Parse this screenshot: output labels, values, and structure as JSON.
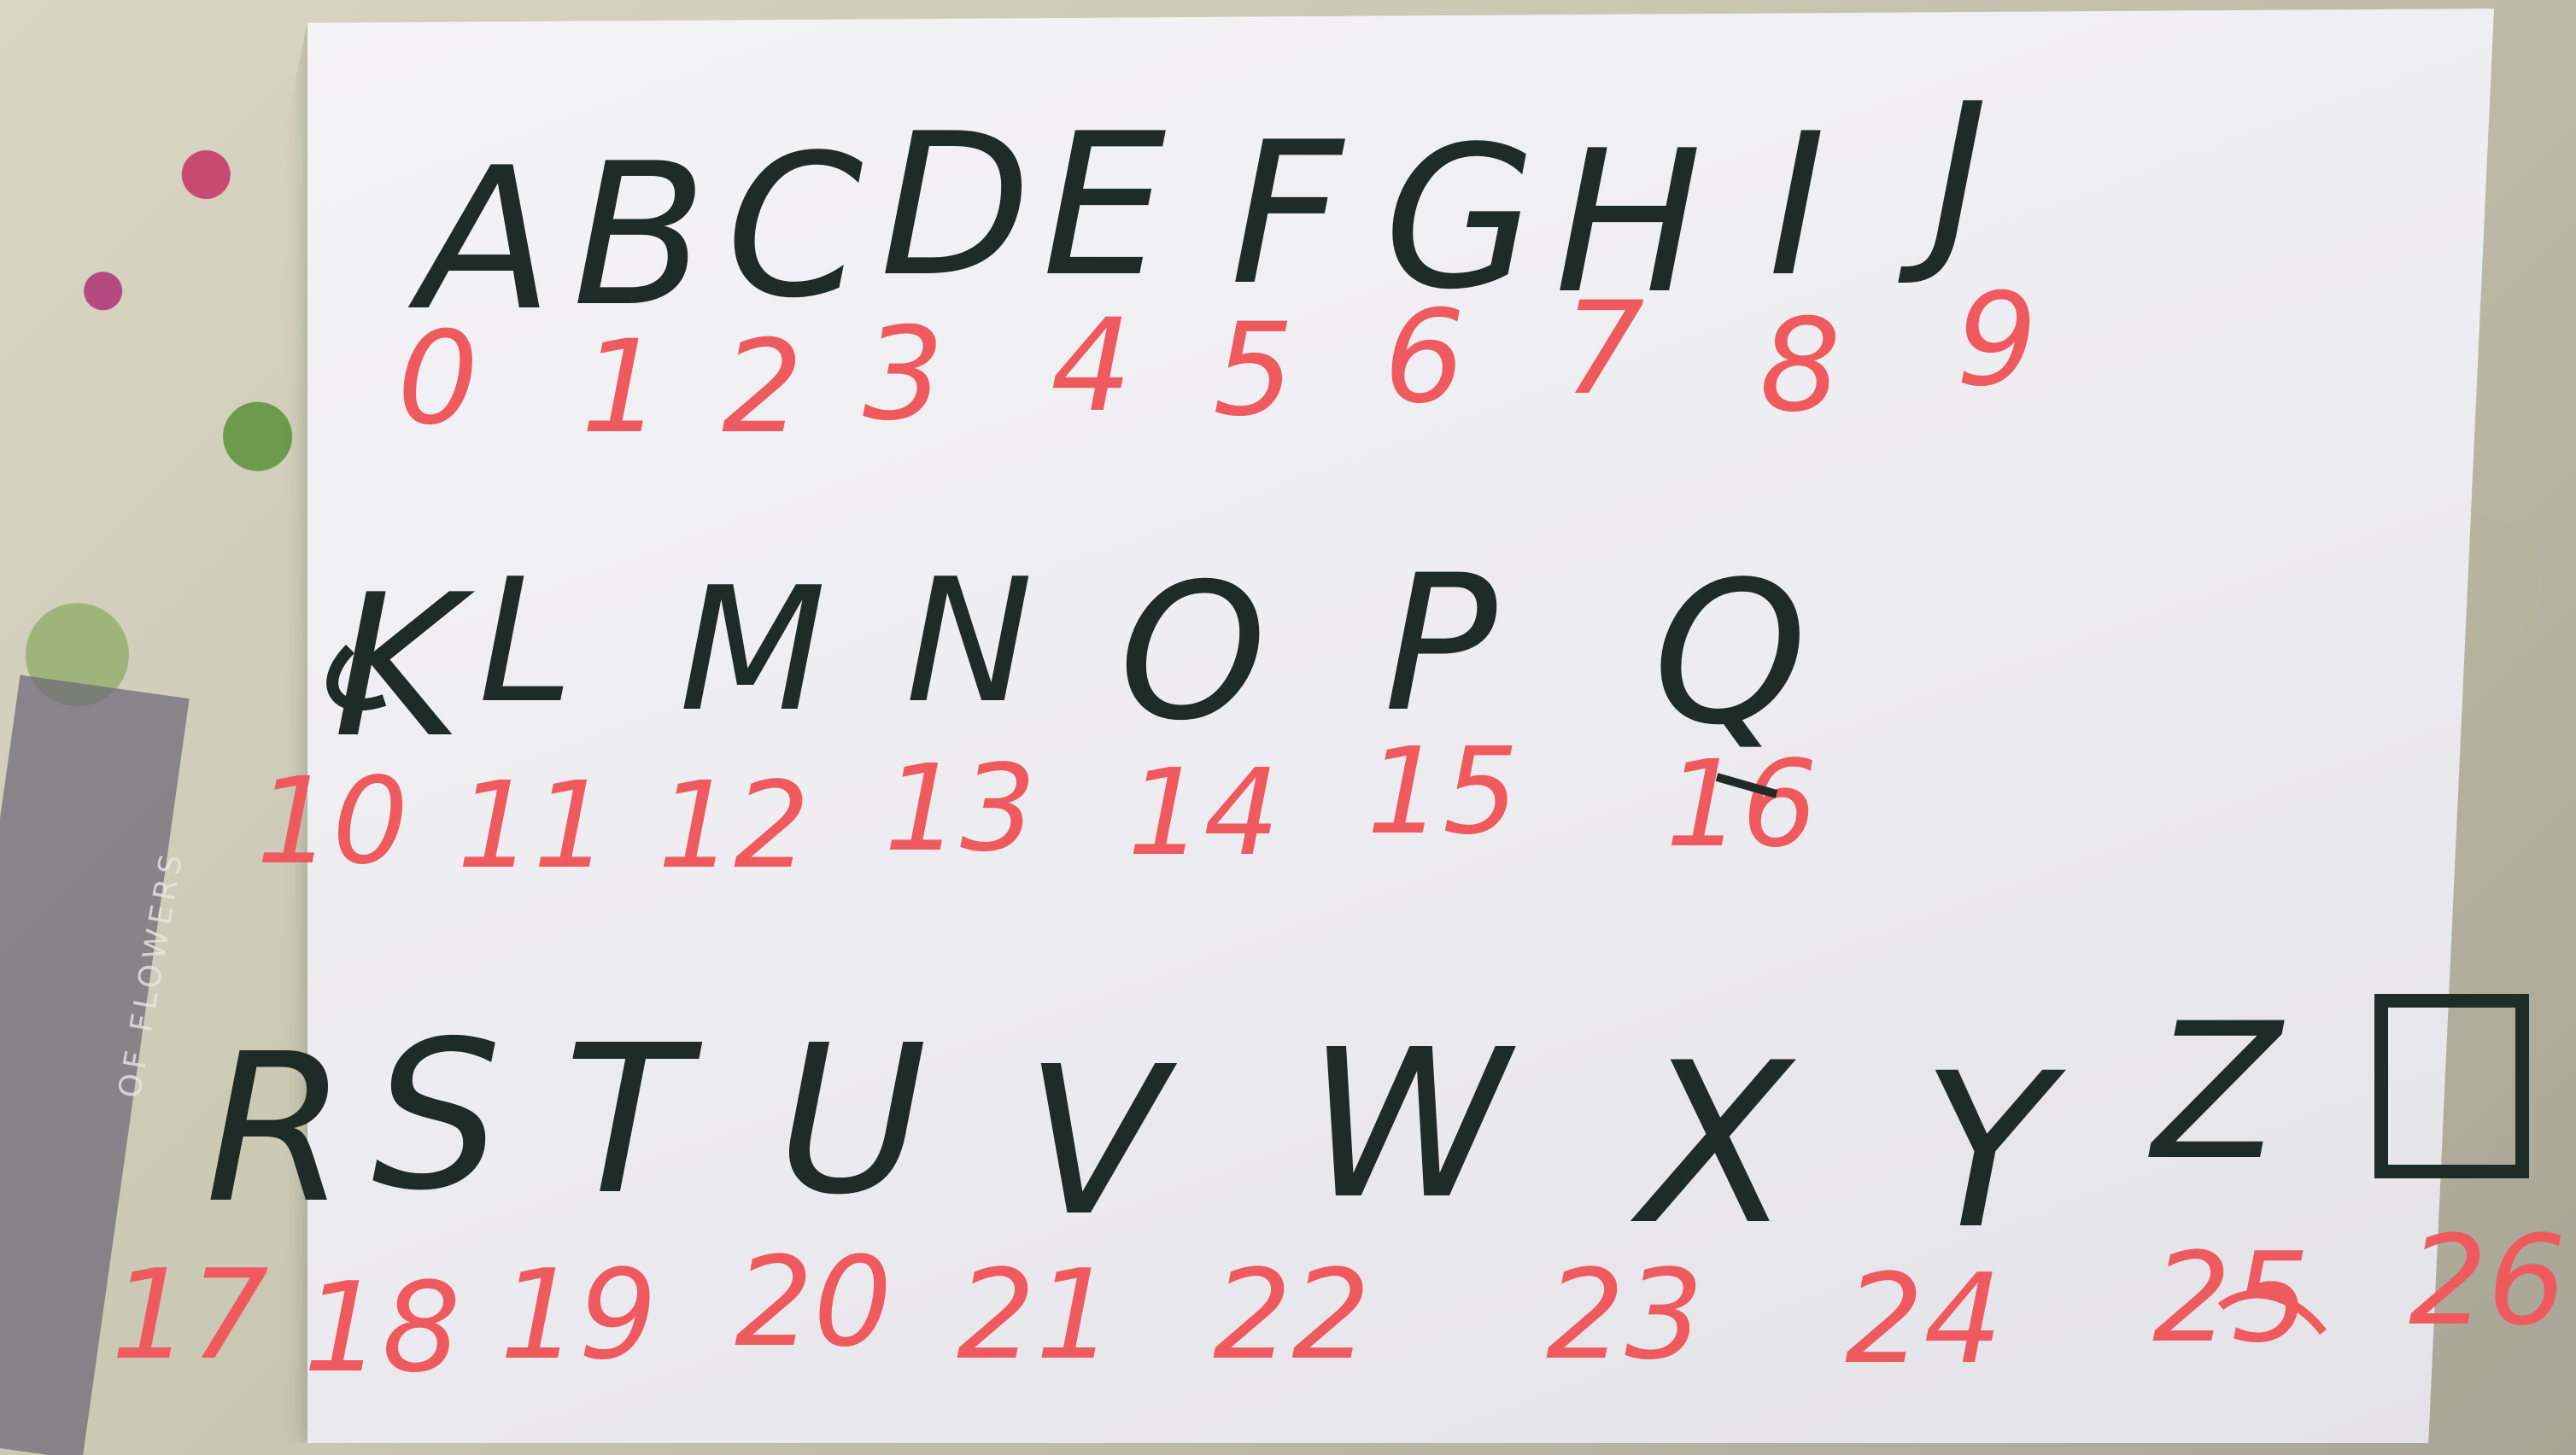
{
  "rows": [
    {
      "letters": [
        "A",
        "B",
        "C",
        "D",
        "E",
        "F",
        "G",
        "H",
        "I",
        "J"
      ],
      "numbers": [
        "0",
        "1",
        "2",
        "3",
        "4",
        "5",
        "6",
        "7",
        "8",
        "9"
      ]
    },
    {
      "letters": [
        "K",
        "L",
        "M",
        "N",
        "O",
        "P",
        "Q"
      ],
      "numbers": [
        "10",
        "11",
        "12",
        "13",
        "14",
        "15",
        "16"
      ]
    },
    {
      "letters": [
        "R",
        "S",
        "T",
        "U",
        "V",
        "W",
        "X",
        "Y",
        "Z"
      ],
      "numbers": [
        "17",
        "18",
        "19",
        "20",
        "21",
        "22",
        "23",
        "24",
        "25",
        "26"
      ]
    }
  ],
  "cloth_text": "OF FLOWERS",
  "colors": {
    "letter_ink": "#1f2b26",
    "number_ink": "#ee5a5e",
    "paper": "#efeef2"
  }
}
